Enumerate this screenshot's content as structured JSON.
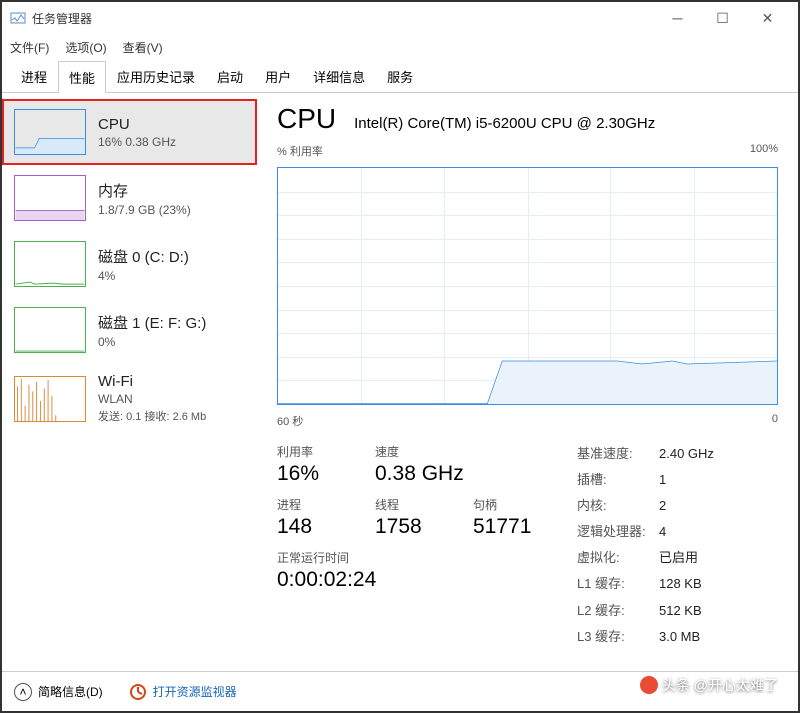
{
  "window": {
    "title": "任务管理器"
  },
  "menus": [
    "文件(F)",
    "选项(O)",
    "查看(V)"
  ],
  "tabs": [
    "进程",
    "性能",
    "应用历史记录",
    "启动",
    "用户",
    "详细信息",
    "服务"
  ],
  "sidebar": [
    {
      "name": "cpu",
      "title": "CPU",
      "sub": "16% 0.38 GHz"
    },
    {
      "name": "mem",
      "title": "内存",
      "sub": "1.8/7.9 GB (23%)"
    },
    {
      "name": "disk0",
      "title": "磁盘 0 (C: D:)",
      "sub": "4%"
    },
    {
      "name": "disk1",
      "title": "磁盘 1 (E: F: G:)",
      "sub": "0%"
    },
    {
      "name": "wifi",
      "title": "Wi-Fi",
      "sub": "WLAN",
      "sub2": "发送: 0.1 接收: 2.6 Mb"
    }
  ],
  "detail": {
    "title": "CPU",
    "model": "Intel(R) Core(TM) i5-6200U CPU @ 2.30GHz",
    "chart_top_left": "% 利用率",
    "chart_top_right": "100%",
    "chart_bottom_left": "60 秒",
    "chart_bottom_right": "0",
    "stats": {
      "util_label": "利用率",
      "util": "16%",
      "speed_label": "速度",
      "speed": "0.38 GHz",
      "proc_label": "进程",
      "proc": "148",
      "thr_label": "线程",
      "thr": "1758",
      "hnd_label": "句柄",
      "hnd": "51771",
      "uptime_label": "正常运行时间",
      "uptime": "0:00:02:24"
    },
    "specs": {
      "base_label": "基准速度:",
      "base": "2.40 GHz",
      "sockets_label": "插槽:",
      "sockets": "1",
      "cores_label": "内核:",
      "cores": "2",
      "logical_label": "逻辑处理器:",
      "logical": "4",
      "virt_label": "虚拟化:",
      "virt": "已启用",
      "l1_label": "L1 缓存:",
      "l1": "128 KB",
      "l2_label": "L2 缓存:",
      "l2": "512 KB",
      "l3_label": "L3 缓存:",
      "l3": "3.0 MB"
    }
  },
  "footer": {
    "less": "简略信息(D)",
    "resmon": "打开资源监视器"
  },
  "watermark": "头条 @开心太难了",
  "chart_data": {
    "type": "line",
    "title": "% 利用率",
    "xlabel": "秒",
    "ylabel": "%",
    "xlim": [
      60,
      0
    ],
    "ylim": [
      0,
      100
    ],
    "x": [
      60,
      55,
      50,
      45,
      40,
      35,
      30,
      25,
      20,
      15,
      10,
      5,
      0
    ],
    "values": [
      0,
      0,
      0,
      0,
      0,
      0,
      0,
      18,
      18,
      17,
      18,
      17,
      18
    ]
  }
}
